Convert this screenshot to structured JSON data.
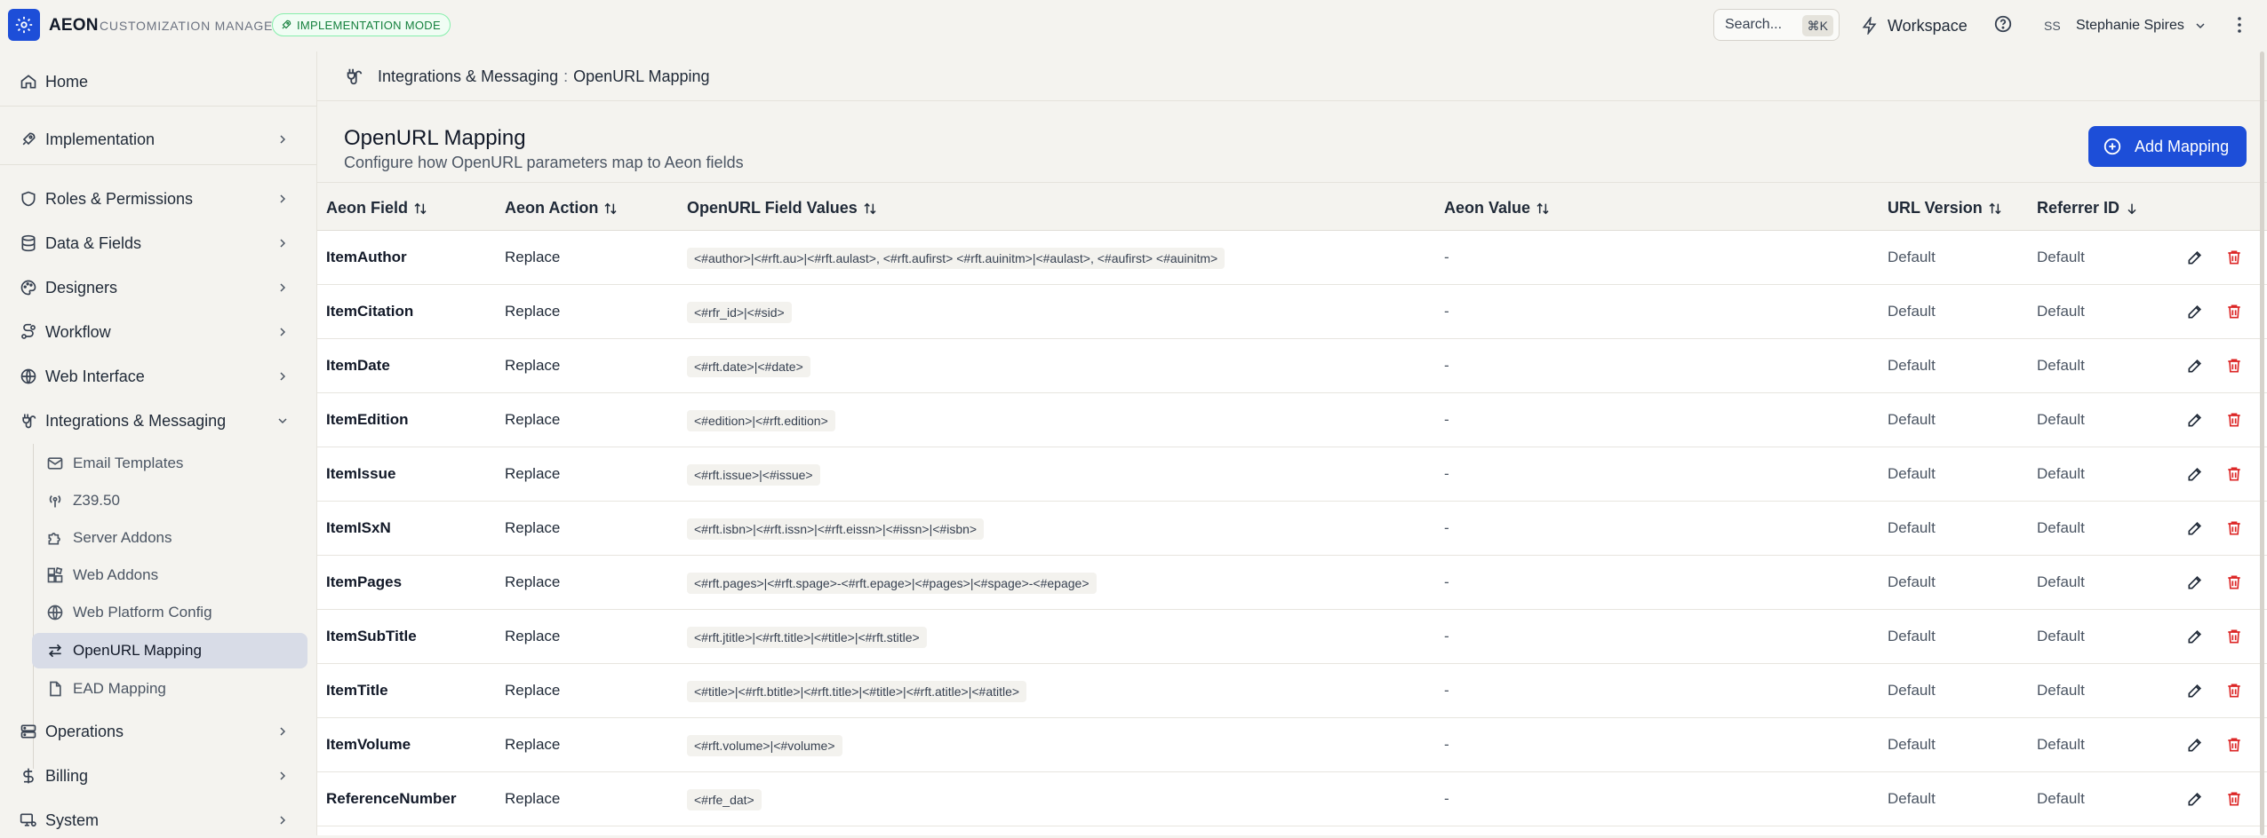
{
  "app": {
    "brand": "AEON",
    "subtitle": "CUSTOMIZATION MANAGER",
    "mode_badge": "IMPLEMENTATION MODE",
    "search_label": "Search...",
    "search_shortcut": "⌘K",
    "workspace_label": "Workspace",
    "user_initials": "SS",
    "user_name": "Stephanie Spires",
    "accent": "#1d4ed8",
    "delete_color": "#dc2626"
  },
  "sidebar": {
    "home": "Home",
    "implementation": "Implementation",
    "roles": "Roles & Permissions",
    "data_fields": "Data & Fields",
    "designers": "Designers",
    "workflow": "Workflow",
    "web_interface": "Web Interface",
    "integrations": "Integrations & Messaging",
    "sub": {
      "email": "Email Templates",
      "z3950": "Z39.50",
      "server_addons": "Server Addons",
      "web_addons": "Web Addons",
      "web_platform": "Web Platform Config",
      "openurl": "OpenURL Mapping",
      "ead": "EAD Mapping"
    },
    "operations": "Operations",
    "billing": "Billing",
    "system": "System"
  },
  "breadcrumb": {
    "parent": "Integrations & Messaging",
    "separator": ":",
    "current": "OpenURL Mapping"
  },
  "page": {
    "title": "OpenURL Mapping",
    "subtitle": "Configure how OpenURL parameters map to Aeon fields",
    "add_button": "Add Mapping"
  },
  "table": {
    "headers": {
      "field": "Aeon Field",
      "action": "Aeon Action",
      "values": "OpenURL Field Values",
      "aeon_value": "Aeon Value",
      "url_version": "URL Version",
      "referrer": "Referrer ID"
    },
    "rows": [
      {
        "field": "ItemAuthor",
        "action": "Replace",
        "values": "<#author>|<#rft.au>|<#rft.aulast>, <#rft.aufirst> <#rft.auinitm>|<#aulast>, <#aufirst> <#auinitm>",
        "aeon_value": "-",
        "url_version": "Default",
        "referrer": "Default"
      },
      {
        "field": "ItemCitation",
        "action": "Replace",
        "values": "<#rfr_id>|<#sid>",
        "aeon_value": "-",
        "url_version": "Default",
        "referrer": "Default"
      },
      {
        "field": "ItemDate",
        "action": "Replace",
        "values": "<#rft.date>|<#date>",
        "aeon_value": "-",
        "url_version": "Default",
        "referrer": "Default"
      },
      {
        "field": "ItemEdition",
        "action": "Replace",
        "values": "<#edition>|<#rft.edition>",
        "aeon_value": "-",
        "url_version": "Default",
        "referrer": "Default"
      },
      {
        "field": "ItemIssue",
        "action": "Replace",
        "values": "<#rft.issue>|<#issue>",
        "aeon_value": "-",
        "url_version": "Default",
        "referrer": "Default"
      },
      {
        "field": "ItemISxN",
        "action": "Replace",
        "values": "<#rft.isbn>|<#rft.issn>|<#rft.eissn>|<#issn>|<#isbn>",
        "aeon_value": "-",
        "url_version": "Default",
        "referrer": "Default"
      },
      {
        "field": "ItemPages",
        "action": "Replace",
        "values": "<#rft.pages>|<#rft.spage>-<#rft.epage>|<#pages>|<#spage>-<#epage>",
        "aeon_value": "-",
        "url_version": "Default",
        "referrer": "Default"
      },
      {
        "field": "ItemSubTitle",
        "action": "Replace",
        "values": "<#rft.jtitle>|<#rft.title>|<#title>|<#rft.stitle>",
        "aeon_value": "-",
        "url_version": "Default",
        "referrer": "Default"
      },
      {
        "field": "ItemTitle",
        "action": "Replace",
        "values": "<#title>|<#rft.btitle>|<#rft.title>|<#title>|<#rft.atitle>|<#atitle>",
        "aeon_value": "-",
        "url_version": "Default",
        "referrer": "Default"
      },
      {
        "field": "ItemVolume",
        "action": "Replace",
        "values": "<#rft.volume>|<#volume>",
        "aeon_value": "-",
        "url_version": "Default",
        "referrer": "Default"
      },
      {
        "field": "ReferenceNumber",
        "action": "Replace",
        "values": "<#rfe_dat>",
        "aeon_value": "-",
        "url_version": "Default",
        "referrer": "Default"
      }
    ]
  }
}
